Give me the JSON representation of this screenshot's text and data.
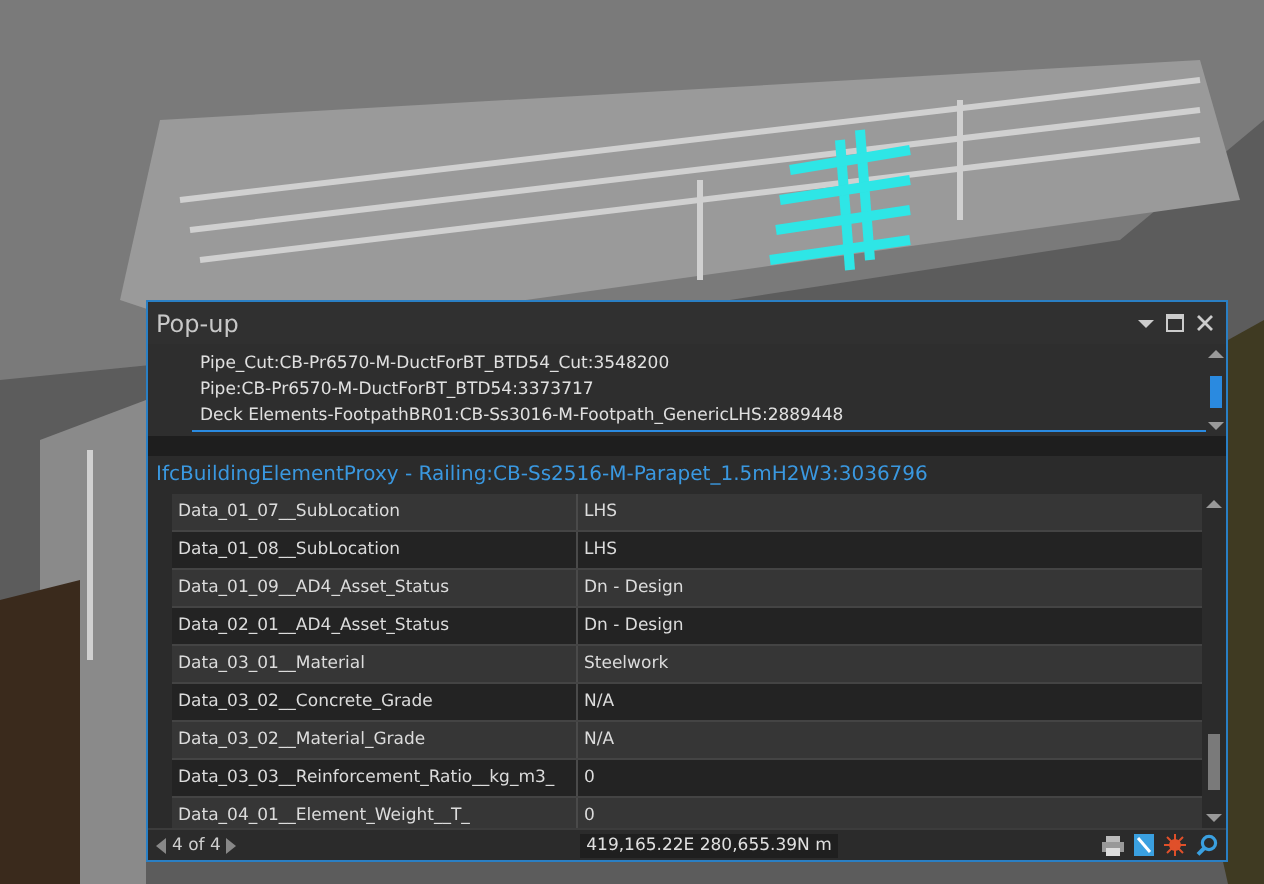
{
  "window": {
    "title": "Pop-up"
  },
  "features": [
    {
      "label": "Pipe_Cut:CB-Pr6570-M-DuctForBT_BTD54_Cut:3548200",
      "selected": false
    },
    {
      "label": "Pipe:CB-Pr6570-M-DuctForBT_BTD54:3373717",
      "selected": false
    },
    {
      "label": "Deck Elements-FootpathBR01:CB-Ss3016-M-Footpath_GenericLHS:2889448",
      "selected": true
    }
  ],
  "feature_title": "IfcBuildingElementProxy - Railing:CB-Ss2516-M-Parapet_1.5mH2W3:3036796",
  "table": {
    "rows": [
      {
        "field": "Data_01_07__SubLocation",
        "value": "LHS"
      },
      {
        "field": "Data_01_08__SubLocation",
        "value": "LHS"
      },
      {
        "field": "Data_01_09__AD4_Asset_Status",
        "value": "Dn - Design"
      },
      {
        "field": "Data_02_01__AD4_Asset_Status",
        "value": "Dn - Design"
      },
      {
        "field": "Data_03_01__Material",
        "value": "Steelwork"
      },
      {
        "field": "Data_03_02__Concrete_Grade",
        "value": "N/A"
      },
      {
        "field": "Data_03_02__Material_Grade",
        "value": "N/A"
      },
      {
        "field": "Data_03_03__Reinforcement_Ratio__kg_m3_",
        "value": "0"
      },
      {
        "field": "Data_04_01__Element_Weight__T_",
        "value": "0"
      }
    ]
  },
  "status_bar": {
    "pager": "4 of 4",
    "coordinates": "419,165.22E 280,655.39N m"
  }
}
